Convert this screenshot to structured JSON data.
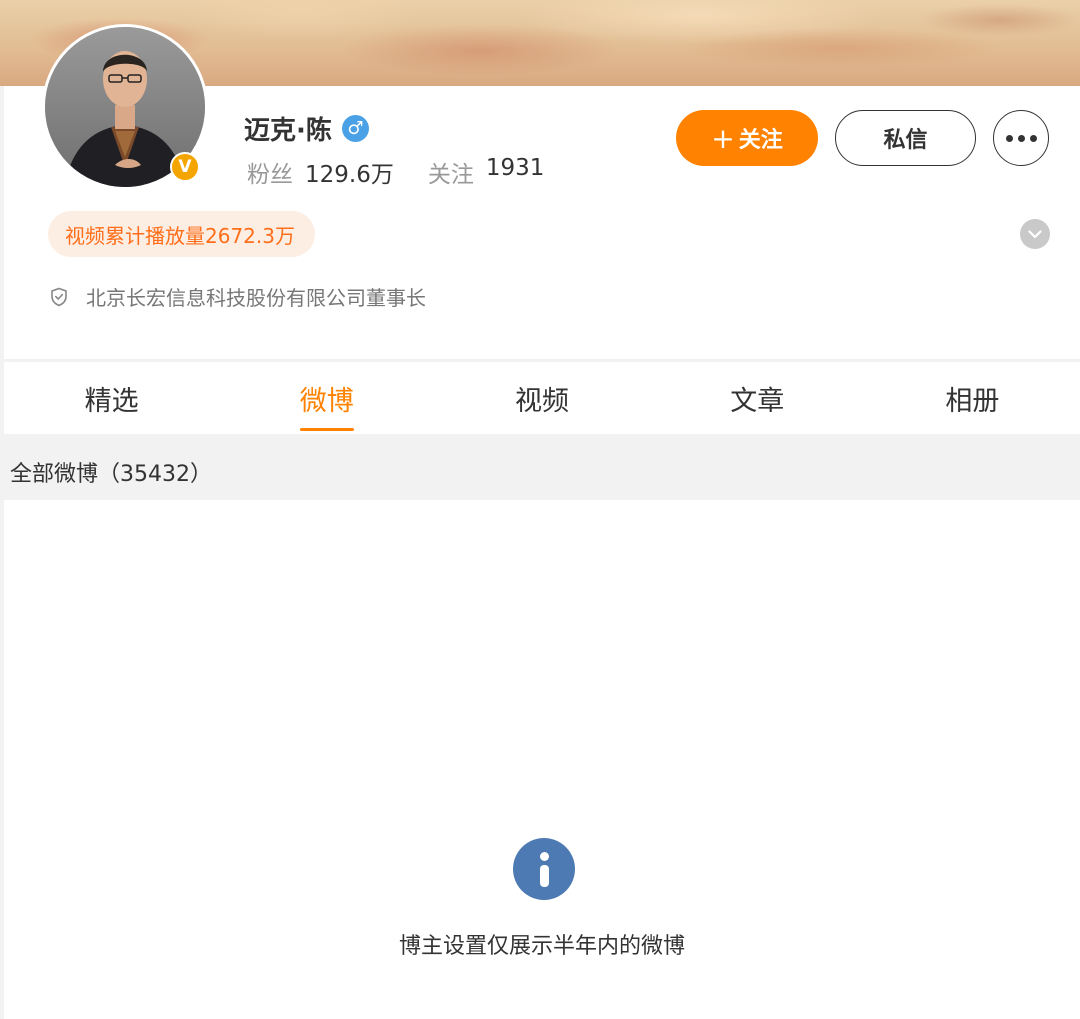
{
  "profile": {
    "name": "迈克·陈",
    "gender_symbol": "♂",
    "verified_symbol": "V",
    "fans_label": "粉丝",
    "fans_value": "129.6万",
    "following_label": "关注",
    "following_value": "1931",
    "play_count_text": "视频累计播放量2672.3万",
    "certification": "北京长宏信息科技股份有限公司董事长"
  },
  "actions": {
    "follow_plus": "+",
    "follow_label": "关注",
    "message_label": "私信"
  },
  "tabs": [
    {
      "label": "精选",
      "active": false
    },
    {
      "label": "微博",
      "active": true
    },
    {
      "label": "视频",
      "active": false
    },
    {
      "label": "文章",
      "active": false
    },
    {
      "label": "相册",
      "active": false
    }
  ],
  "feed": {
    "count_text": "全部微博（35432）",
    "notice": "博主设置仅展示半年内的微博"
  },
  "colors": {
    "accent": "#ff8200",
    "gender_badge": "#4aa1e6",
    "verified_badge": "#f5a500",
    "info_icon": "#4e7ab3"
  }
}
